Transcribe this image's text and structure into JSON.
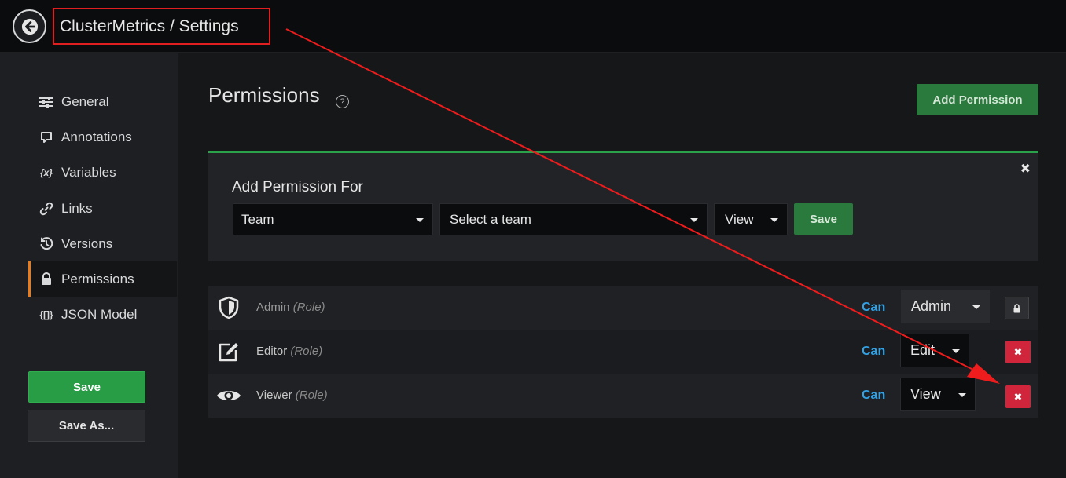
{
  "header": {
    "title": "ClusterMetrics / Settings",
    "back_icon": "arrow-left-icon"
  },
  "sidebar": {
    "items": [
      {
        "label": "General",
        "icon": "sliders-icon"
      },
      {
        "label": "Annotations",
        "icon": "comment-icon"
      },
      {
        "label": "Variables",
        "icon": "variable-icon"
      },
      {
        "label": "Links",
        "icon": "link-icon"
      },
      {
        "label": "Versions",
        "icon": "history-icon"
      },
      {
        "label": "Permissions",
        "icon": "lock-icon",
        "active": true
      },
      {
        "label": "JSON Model",
        "icon": "json-icon"
      }
    ],
    "save_label": "Save",
    "save_as_label": "Save As..."
  },
  "main": {
    "title": "Permissions",
    "help_glyph": "?",
    "add_permission_label": "Add Permission"
  },
  "add_panel": {
    "label": "Add Permission For",
    "type_value": "Team",
    "target_value": "Select a team",
    "level_value": "View",
    "save_label": "Save",
    "close_glyph": "✖"
  },
  "permissions": [
    {
      "name": "Admin",
      "kind": "(Role)",
      "can": "Can",
      "level": "Admin",
      "icon": "shield-icon",
      "locked": true
    },
    {
      "name": "Editor",
      "kind": "(Role)",
      "can": "Can",
      "level": "Edit",
      "icon": "edit-icon",
      "locked": false
    },
    {
      "name": "Viewer",
      "kind": "(Role)",
      "can": "Can",
      "level": "View",
      "icon": "eye-icon",
      "locked": false
    }
  ],
  "delete_glyph": "✖",
  "colors": {
    "accent_green": "#299c46",
    "annotation_red": "#e02020",
    "link_blue": "#33a2e5",
    "active_orange": "#eb7b18",
    "danger_red": "#d0253a"
  }
}
